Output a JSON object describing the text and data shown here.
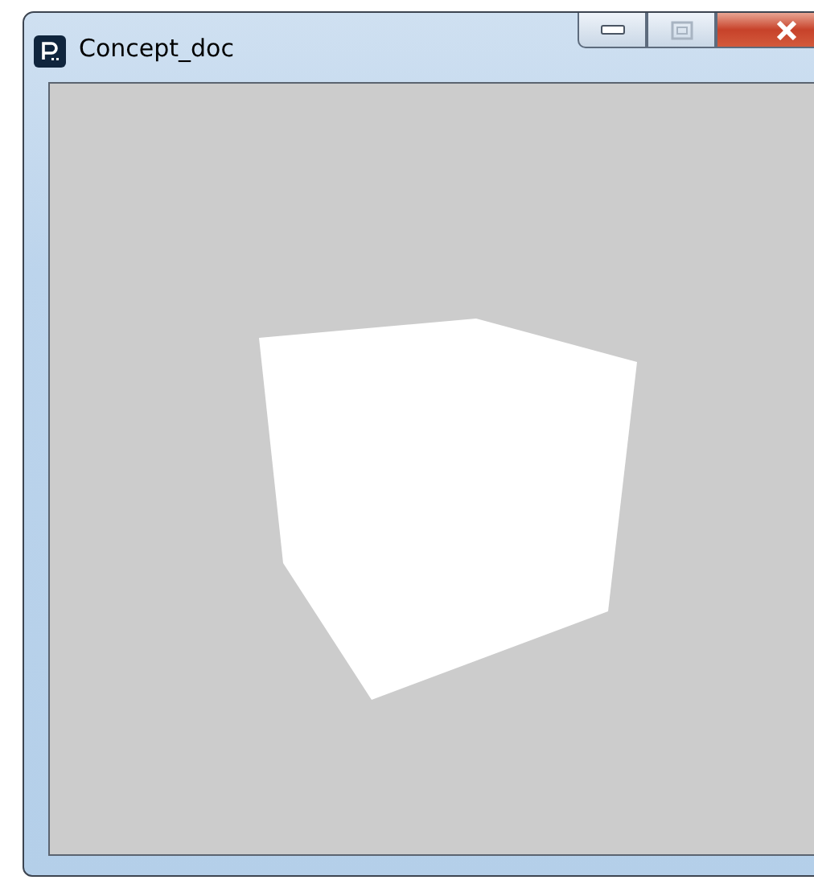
{
  "window": {
    "title": "Concept_doc"
  }
}
